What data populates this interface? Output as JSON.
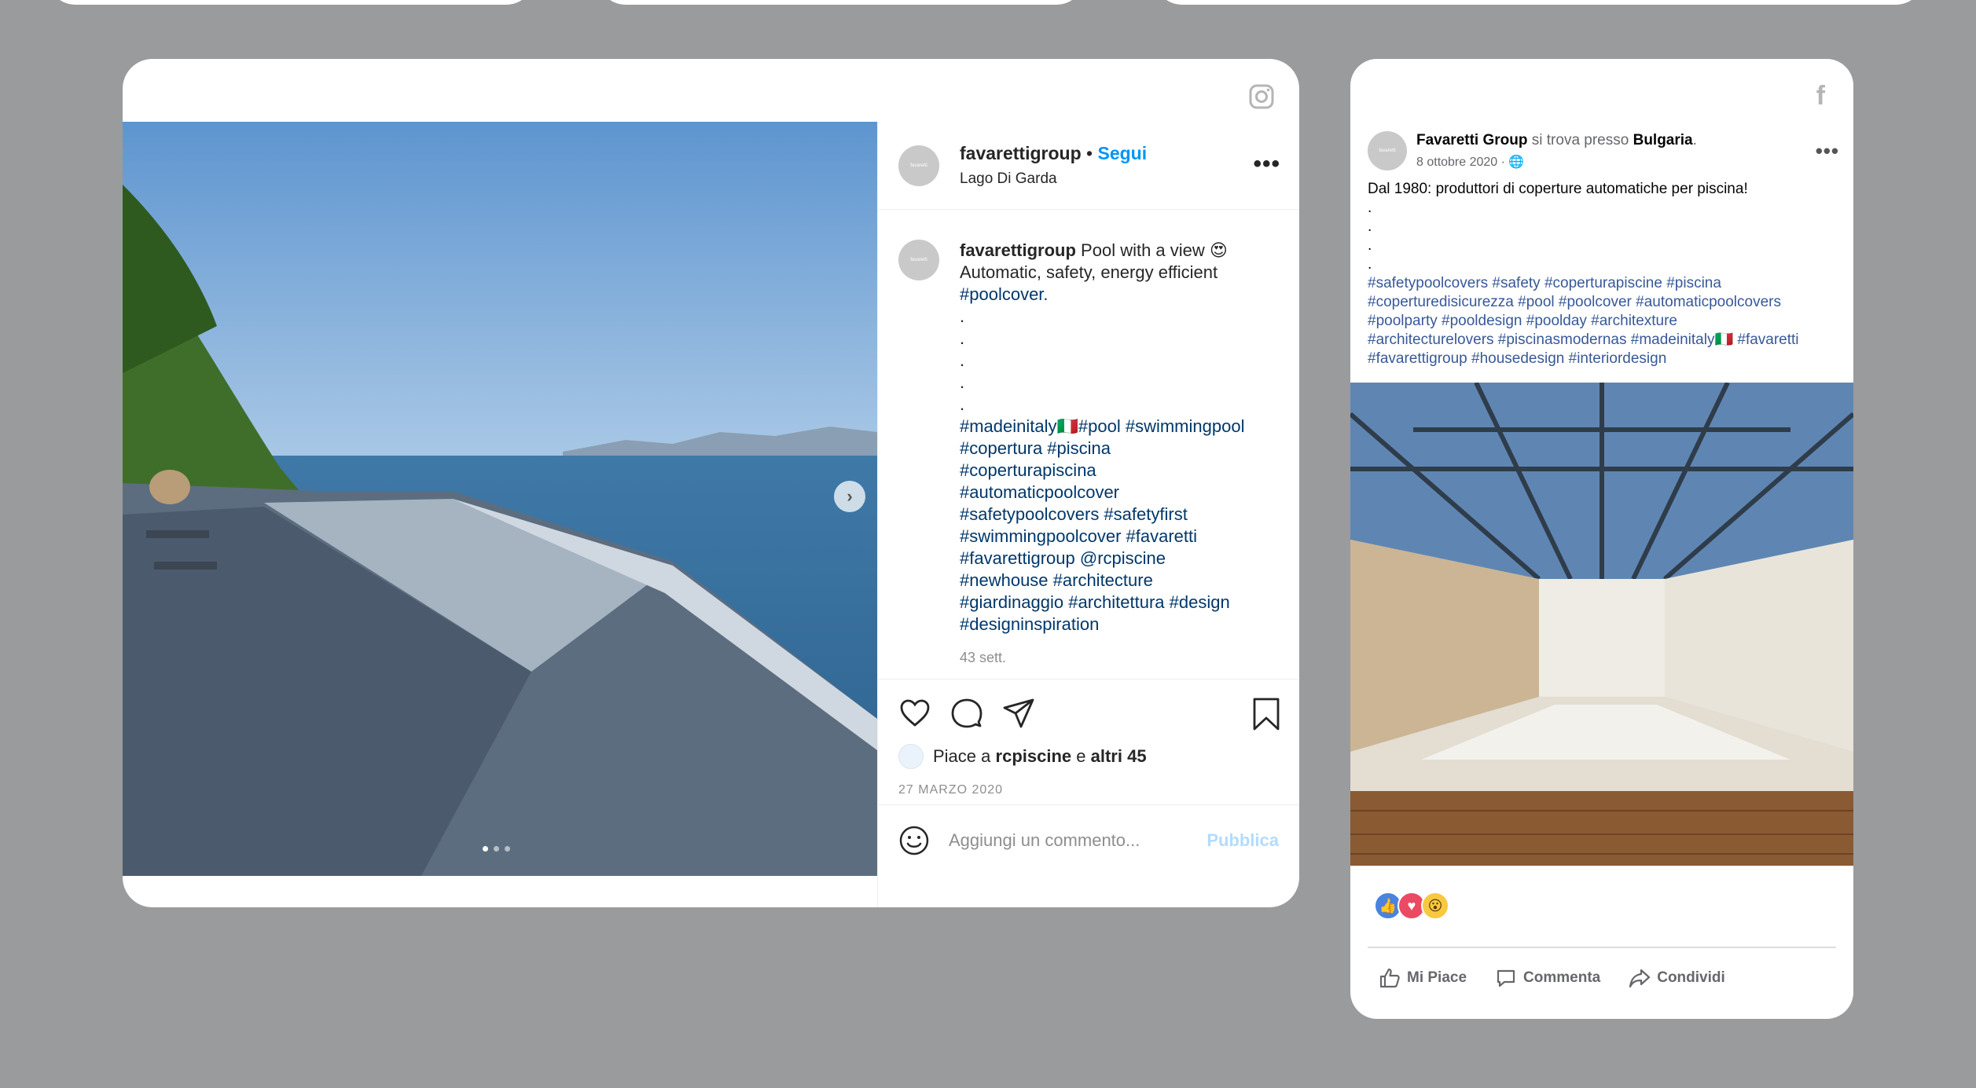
{
  "instagram": {
    "username": "favarettigroup",
    "separator": "•",
    "follow_label": "Segui",
    "location": "Lago Di Garda",
    "more_label": "•••",
    "avatar_text": "favaretti",
    "caption": {
      "user": "favarettigroup",
      "text_line1": "Pool with a view 😍",
      "text_line2": "Automatic, safety, energy efficient",
      "text_line3": "#poolcover.",
      "dots": [
        ".",
        ".",
        ".",
        ".",
        "."
      ],
      "hashtags": [
        "#madeinitaly🇮🇹#pool #swimmingpool",
        "#copertura #piscina",
        "#coperturapiscina",
        "#automaticpoolcover",
        "#safetypoolcovers #safetyfirst",
        "#swimmingpoolcover #favaretti",
        "#favarettigroup @rcpiscine",
        "#newhouse #architecture",
        "#giardinaggio #architettura #design",
        "#designinspiration"
      ],
      "time": "43 sett."
    },
    "likes": {
      "prefix": "Piace a",
      "user": "rcpiscine",
      "middle": "e",
      "others": "altri 45"
    },
    "date": "27 MARZO 2020",
    "comment_placeholder": "Aggiungi un commento...",
    "publish_label": "Pubblica",
    "next_arrow": "›"
  },
  "facebook": {
    "logo": "f",
    "page_name": "Favaretti Group",
    "location_prefix": "si trova presso",
    "location": "Bulgaria",
    "date": "8 ottobre 2020 · 🌐",
    "more_label": "•••",
    "avatar_text": "favaretti",
    "post_line1": "Dal 1980: produttori di coperture automatiche per piscina!",
    "dots": [
      ".",
      ".",
      ".",
      "."
    ],
    "hashtags": [
      "#safetypoolcovers #safety #coperturapiscine #piscina",
      "#coperturedisicurezza #pool #poolcover #automaticpoolcovers",
      "#poolparty #pooldesign #poolday #architexture",
      "#architecturelovers #piscinasmodernas #madeinitaly🇮🇹 #favaretti",
      "#favarettigroup #housedesign #interiordesign"
    ],
    "reactions": [
      "👍",
      "♥",
      "😮"
    ],
    "like_label": "Mi Piace",
    "comment_label": "Commenta",
    "share_label": "Condividi"
  }
}
